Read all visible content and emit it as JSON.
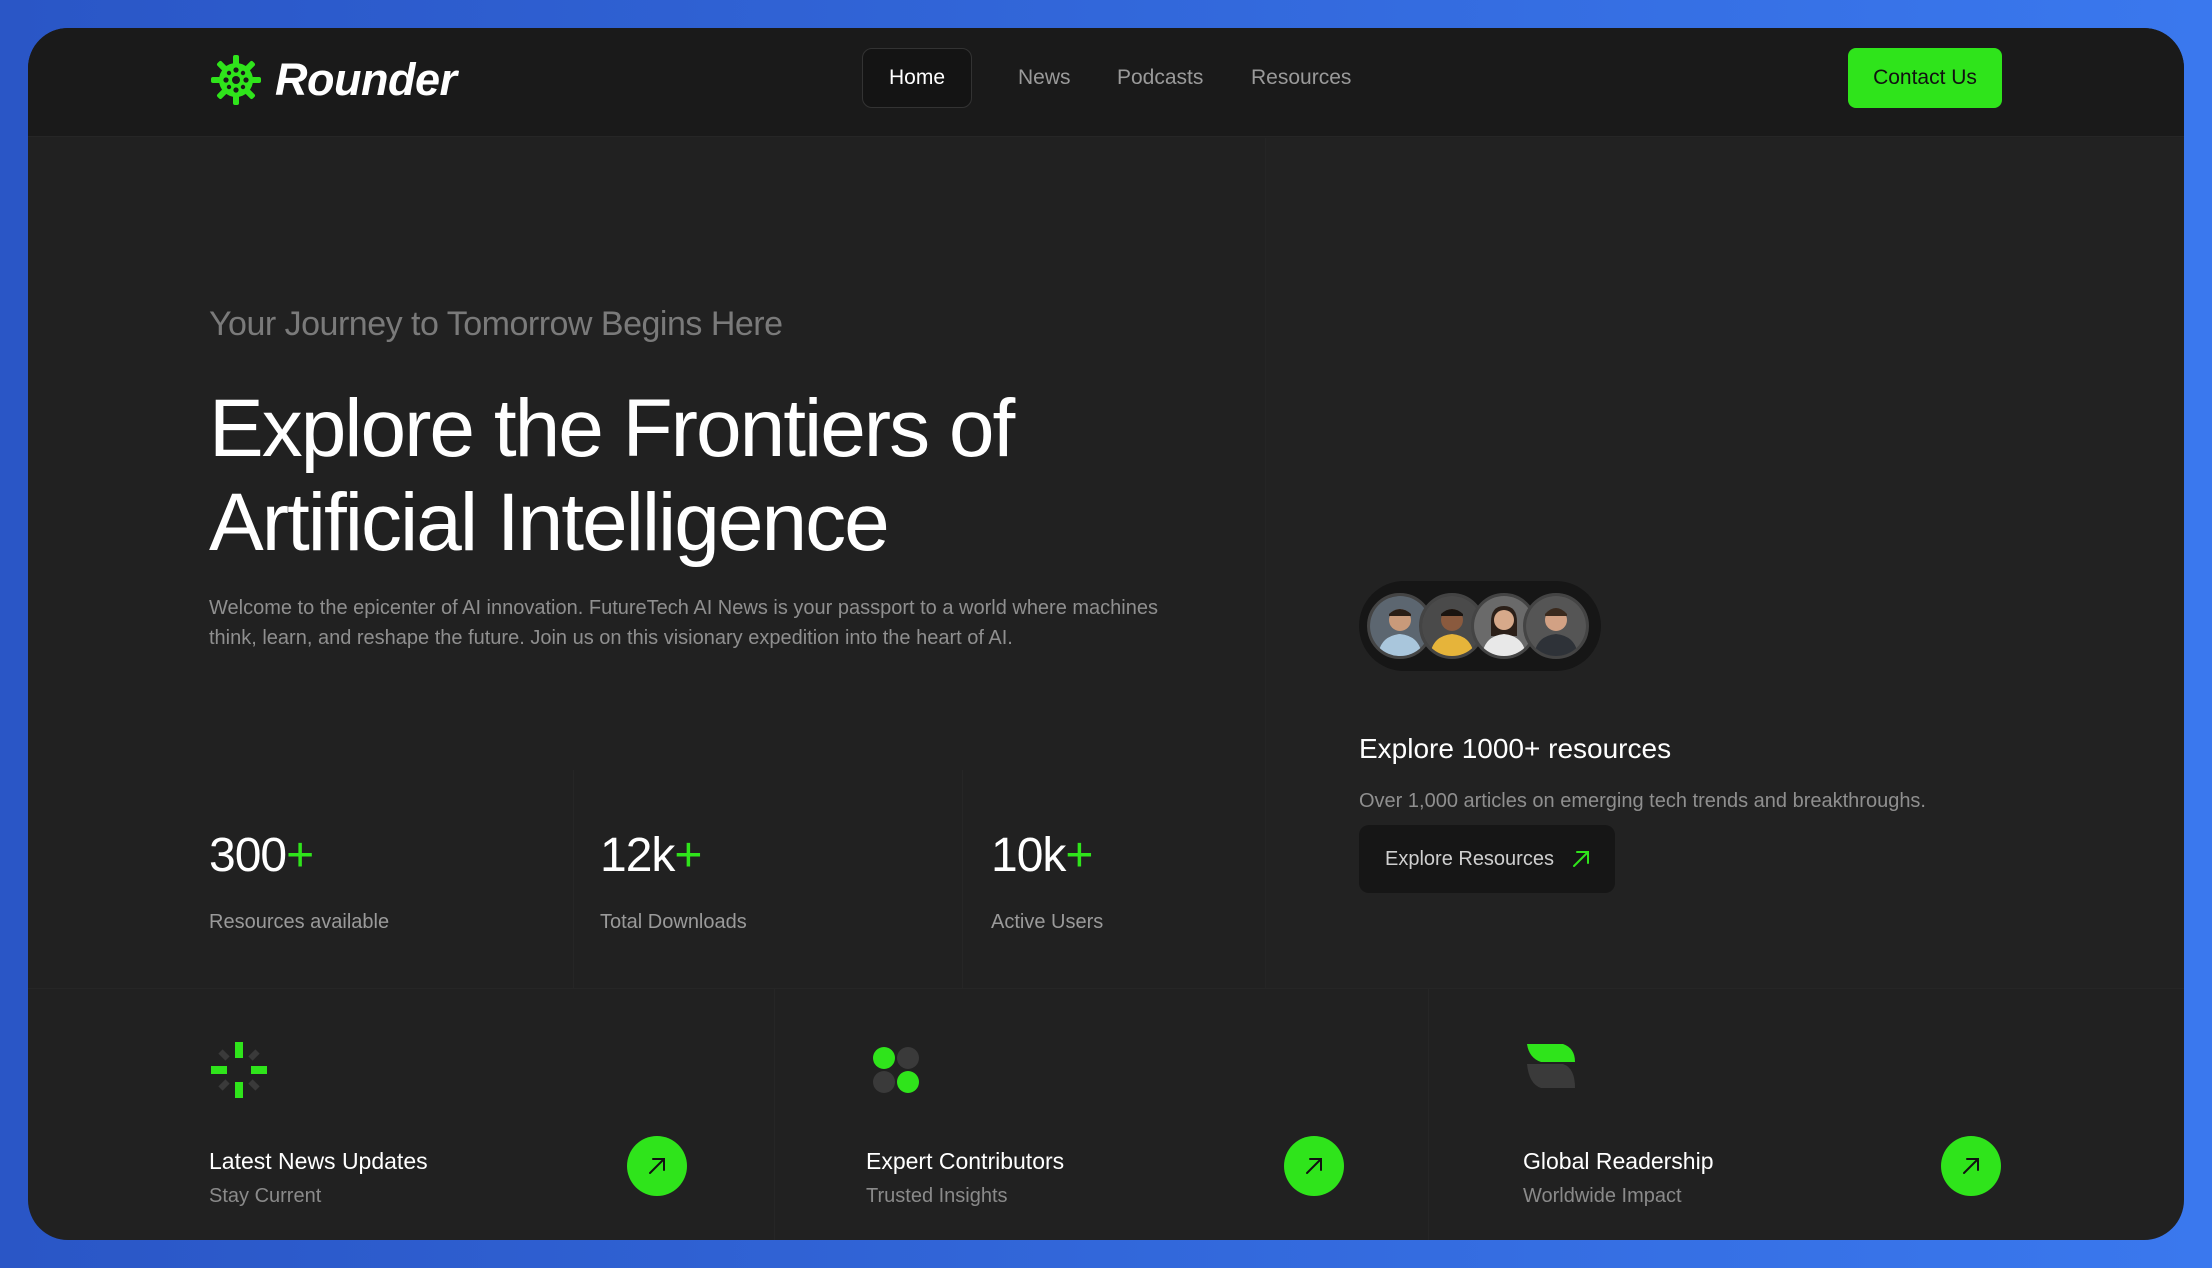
{
  "header": {
    "logo_text": "Rounder",
    "nav": [
      "Home",
      "News",
      "Podcasts",
      "Resources"
    ],
    "active_nav": "Home",
    "contact_label": "Contact Us"
  },
  "hero": {
    "tagline": "Your Journey to Tomorrow Begins Here",
    "title_line1": "Explore the Frontiers of",
    "title_line2": "Artificial Intelligence",
    "description": "Welcome to the epicenter of AI innovation. FutureTech AI News is your passport to a world where machines think, learn, and reshape the future. Join us on this visionary expedition into the heart of AI."
  },
  "stats": [
    {
      "value": "300",
      "suffix": "+",
      "label": "Resources available"
    },
    {
      "value": "12k",
      "suffix": "+",
      "label": "Total Downloads"
    },
    {
      "value": "10k",
      "suffix": "+",
      "label": "Active Users"
    }
  ],
  "resources": {
    "title": "Explore 1000+ resources",
    "description": "Over 1,000 articles on emerging tech trends and breakthroughs.",
    "button_label": "Explore Resources"
  },
  "features": [
    {
      "title": "Latest News Updates",
      "subtitle": "Stay Current",
      "icon": "spark-icon"
    },
    {
      "title": "Expert Contributors",
      "subtitle": "Trusted Insights",
      "icon": "clover-icon"
    },
    {
      "title": "Global Readership",
      "subtitle": "Worldwide Impact",
      "icon": "leaf-icon"
    }
  ],
  "colors": {
    "accent": "#2fe41b",
    "background": "#212121",
    "header": "#1a1a1a",
    "frame": "#2a56c6"
  }
}
